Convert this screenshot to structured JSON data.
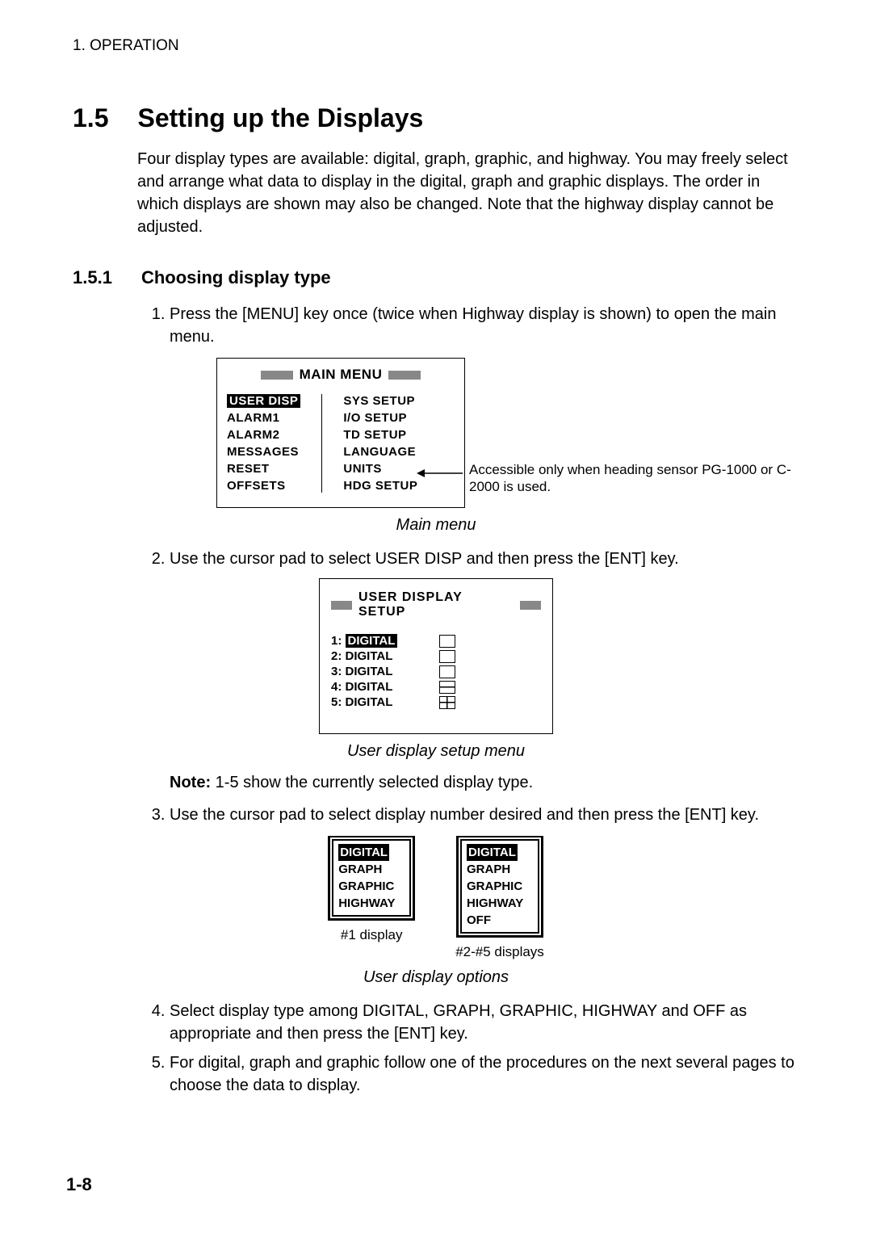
{
  "header": "1. OPERATION",
  "section": {
    "number": "1.5",
    "title": "Setting up the Displays"
  },
  "intro": "Four display types are available: digital, graph, graphic, and highway. You may freely select and arrange what data to display in the digital, graph and graphic displays. The order in which displays are shown may also be changed. Note that the highway display cannot be adjusted.",
  "subsection": {
    "number": "1.5.1",
    "title": "Choosing display type"
  },
  "steps": {
    "s1": "Press the [MENU] key once (twice when Highway display is shown) to open the main menu.",
    "s2": "Use the cursor pad to select USER DISP and then press the [ENT] key.",
    "s3": "Use the cursor pad to select display number desired and then press the [ENT] key.",
    "s4": "Select display type among DIGITAL, GRAPH, GRAPHIC, HIGHWAY and OFF as appropriate and then press the [ENT] key.",
    "s5": "For digital, graph and graphic follow one of the procedures on the next several pages to choose the data to display."
  },
  "mainmenu": {
    "title": "MAIN MENU",
    "left": [
      "USER DISP",
      "ALARM1",
      "ALARM2",
      "MESSAGES",
      "RESET",
      "OFFSETS"
    ],
    "right": [
      "SYS SETUP",
      "I/O SETUP",
      "TD SETUP",
      "LANGUAGE",
      "UNITS",
      "HDG SETUP"
    ],
    "note": "Accessible only when heading sensor PG-1000 or C-2000 is used.",
    "caption": "Main menu"
  },
  "uds": {
    "title": "USER DISPLAY SETUP",
    "rows": [
      "1: DIGITAL",
      "2: DIGITAL",
      "3: DIGITAL",
      "4: DIGITAL",
      "5: DIGITAL"
    ],
    "selected_word": "DIGITAL",
    "caption": "User display setup menu"
  },
  "note_label": "Note:",
  "note_text": " 1-5 show the currently selected display type.",
  "opts": {
    "box1": [
      "DIGITAL",
      "GRAPH",
      "GRAPHIC",
      "HIGHWAY"
    ],
    "box2": [
      "DIGITAL",
      "GRAPH",
      "GRAPHIC",
      "HIGHWAY",
      "OFF"
    ],
    "label1": "#1 display",
    "label2": "#2-#5 displays",
    "caption": "User display options"
  },
  "page_number": "1-8"
}
